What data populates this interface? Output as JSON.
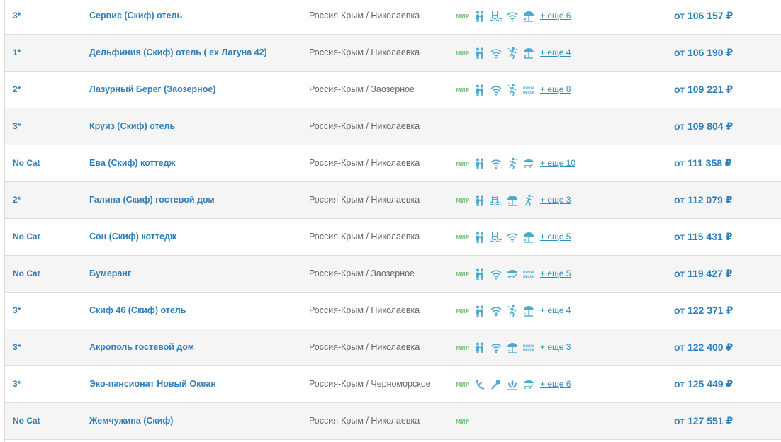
{
  "colors": {
    "link": "#2f7fba",
    "icon": "#4fa8d0",
    "mir": "#7cc47f",
    "location": "#666666"
  },
  "hotels": [
    {
      "category": "3*",
      "name": "Сервис (Скиф) отель",
      "location": "Россия-Крым / Николаевка",
      "amenities": [
        "mir-icon",
        "family-icon",
        "pool-icon",
        "wifi-icon",
        "beach-umbrella-icon"
      ],
      "more": "+ еще 6",
      "price": "от 106 157 ₽"
    },
    {
      "category": "1*",
      "name": "Дельфиния (Скиф) отель ( ex Лагуна 42)",
      "location": "Россия-Крым / Николаевка",
      "amenities": [
        "mir-icon",
        "family-icon",
        "wifi-icon",
        "animation-icon",
        "beach-umbrella-icon"
      ],
      "more": "+ еще 4",
      "price": "от 106 190 ₽"
    },
    {
      "category": "2*",
      "name": "Лазурный Берег (Заозерное)",
      "location": "Россия-Крым / Заозерное",
      "amenities": [
        "mir-icon",
        "family-icon",
        "wifi-icon",
        "animation-icon",
        "sand-beach-icon"
      ],
      "more": "+ еще 8",
      "price": "от 109 221 ₽"
    },
    {
      "category": "3*",
      "name": "Круиз (Скиф) отель",
      "location": "Россия-Крым / Николаевка",
      "amenities": [],
      "more": "",
      "price": "от 109 804 ₽"
    },
    {
      "category": "No Cat",
      "name": "Ева (Скиф) коттедж",
      "location": "Россия-Крым / Николаевка",
      "amenities": [
        "mir-icon",
        "family-icon",
        "wifi-icon",
        "animation-icon",
        "sunbed-icon"
      ],
      "more": "+ еще 10",
      "price": "от 111 358 ₽"
    },
    {
      "category": "2*",
      "name": "Галина (Скиф) гостевой дом",
      "location": "Россия-Крым / Николаевка",
      "amenities": [
        "mir-icon",
        "family-icon",
        "pool-icon",
        "beach-umbrella-icon",
        "animation-icon"
      ],
      "more": "+ еще 3",
      "price": "от 112 079 ₽"
    },
    {
      "category": "No Cat",
      "name": "Сон (Скиф) коттедж",
      "location": "Россия-Крым / Николаевка",
      "amenities": [
        "mir-icon",
        "family-icon",
        "pool-icon",
        "wifi-icon",
        "beach-umbrella-icon"
      ],
      "more": "+ еще 5",
      "price": "от 115 431 ₽"
    },
    {
      "category": "No Cat",
      "name": "Бумеранг",
      "location": "Россия-Крым / Заозерное",
      "amenities": [
        "mir-icon",
        "family-icon",
        "wifi-icon",
        "sunbed-icon",
        "sand-beach-icon"
      ],
      "more": "+ еще 5",
      "price": "от 119 427 ₽"
    },
    {
      "category": "3*",
      "name": "Скиф 46 (Скиф) отель",
      "location": "Россия-Крым / Николаевка",
      "amenities": [
        "mir-icon",
        "family-icon",
        "wifi-icon",
        "animation-icon",
        "beach-umbrella-icon"
      ],
      "more": "+ еще 4",
      "price": "от 122 371 ₽"
    },
    {
      "category": "3*",
      "name": "Акрополь гостевой дом",
      "location": "Россия-Крым / Николаевка",
      "amenities": [
        "mir-icon",
        "family-icon",
        "wifi-icon",
        "beach-umbrella-icon",
        "sand-beach-icon"
      ],
      "more": "+ еще 3",
      "price": "от 122 400 ₽"
    },
    {
      "category": "3*",
      "name": "Эко-пансионат Новый Океан",
      "location": "Россия-Крым / Черноморское",
      "amenities": [
        "mir-icon",
        "massage-icon",
        "karaoke-icon",
        "spa-icon",
        "sunbed-icon"
      ],
      "more": "+ еще 6",
      "price": "от 125 449 ₽"
    },
    {
      "category": "No Cat",
      "name": "Жемчужина (Скиф)",
      "location": "Россия-Крым / Николаевка",
      "amenities": [
        "mir-icon"
      ],
      "more": "",
      "price": "от 127 551 ₽"
    }
  ]
}
